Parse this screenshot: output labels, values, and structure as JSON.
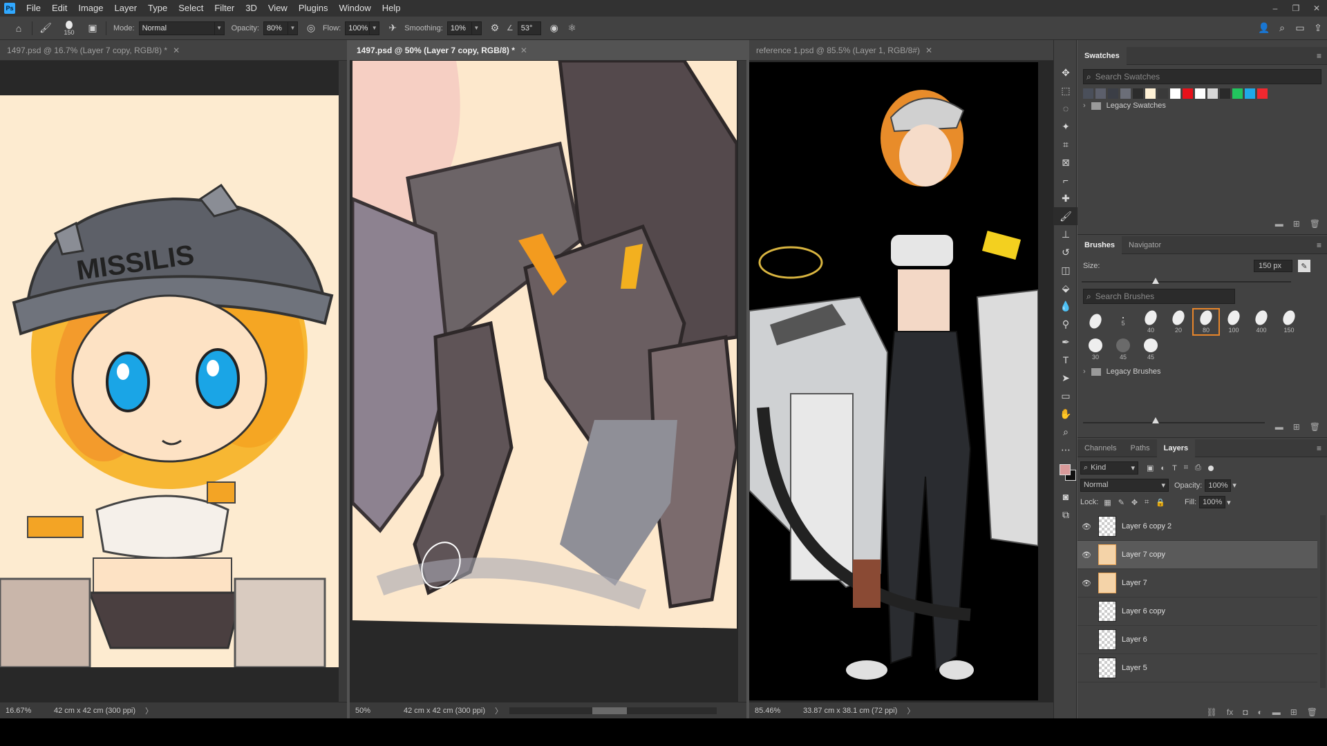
{
  "app": {
    "logo": "Ps"
  },
  "menu": [
    "File",
    "Edit",
    "Image",
    "Layer",
    "Type",
    "Select",
    "Filter",
    "3D",
    "View",
    "Plugins",
    "Window",
    "Help"
  ],
  "window_controls": {
    "minimize": "–",
    "restore": "❐",
    "close": "✕"
  },
  "options": {
    "brush_size": "150",
    "mode_label": "Mode:",
    "mode_value": "Normal",
    "opacity_label": "Opacity:",
    "opacity_value": "80%",
    "flow_label": "Flow:",
    "flow_value": "100%",
    "smoothing_label": "Smoothing:",
    "smoothing_value": "10%",
    "angle_value": "53°"
  },
  "docs": [
    {
      "tab": "1497.psd @ 16.7% (Layer 7 copy, RGB/8) *",
      "zoom": "16.67%",
      "dims": "42 cm x 42 cm (300 ppi)"
    },
    {
      "tab": "1497.psd @ 50% (Layer 7 copy, RGB/8) *",
      "zoom": "50%",
      "dims": "42 cm x 42 cm (300 ppi)"
    },
    {
      "tab": "reference 1.psd @ 85.5% (Layer 1, RGB/8#)",
      "zoom": "85.46%",
      "dims": "33.87 cm x 38.1 cm (72 ppi)"
    }
  ],
  "art_text": {
    "cap": "MISSILIS"
  },
  "swatches": {
    "tab": "Swatches",
    "search_placeholder": "Search Swatches",
    "colors": [
      "#4a4f5a",
      "#5c5f6b",
      "#3b3e46",
      "#6b6e78",
      "#2c2c2c",
      "#fff1d6",
      "#3a3a3a",
      "#ffffff",
      "#e8111a",
      "#ffffff",
      "#d8d8d8",
      "#2a2a2a",
      "#22c55e",
      "#1fa9e8",
      "#f0282f"
    ],
    "group": "Legacy Swatches"
  },
  "brushes": {
    "tabs": [
      "Brushes",
      "Navigator"
    ],
    "size_label": "Size:",
    "size_value": "150 px",
    "search_placeholder": "Search Brushes",
    "row1": [
      "",
      "5",
      "40",
      "20",
      "80",
      "100",
      "400",
      "150"
    ],
    "row2": [
      "30",
      "45",
      "45"
    ],
    "group": "Legacy Brushes"
  },
  "layers_panel": {
    "tabs": [
      "Channels",
      "Paths",
      "Layers"
    ],
    "kind": "Kind",
    "blend": "Normal",
    "opacity_label": "Opacity:",
    "opacity_value": "100%",
    "lock_label": "Lock:",
    "fill_label": "Fill:",
    "fill_value": "100%",
    "layers": [
      {
        "name": "Layer 6 copy 2",
        "visible": true,
        "selected": false
      },
      {
        "name": "Layer 7 copy",
        "visible": true,
        "selected": true
      },
      {
        "name": "Layer 7",
        "visible": true,
        "selected": false
      },
      {
        "name": "Layer 6 copy",
        "visible": false,
        "selected": false
      },
      {
        "name": "Layer 6",
        "visible": false,
        "selected": false
      },
      {
        "name": "Layer 5",
        "visible": false,
        "selected": false
      }
    ]
  }
}
